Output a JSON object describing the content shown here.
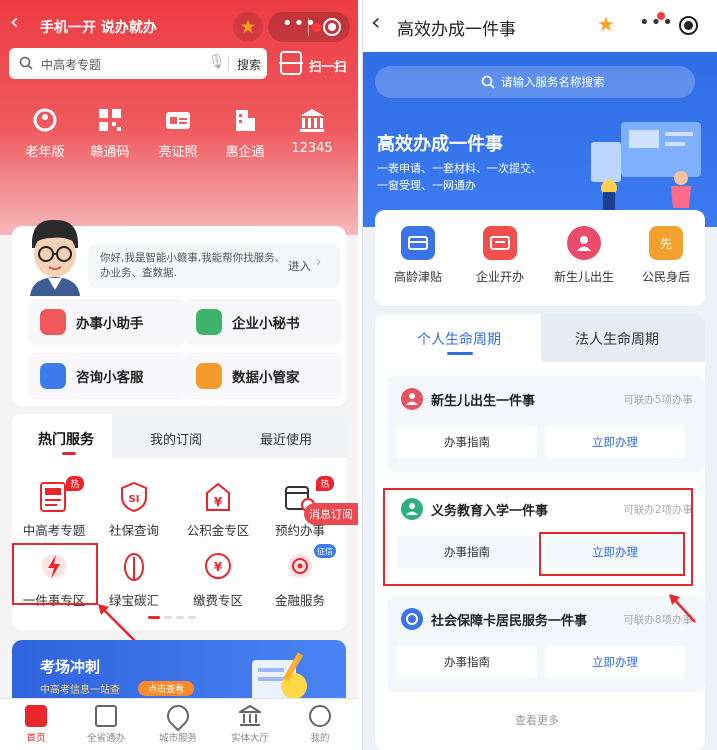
{
  "left": {
    "header": {
      "back_icon": "chevron-left-icon",
      "title": "手机一开 说办就办",
      "star_icon": "star-icon",
      "more_icon": "more-dots-icon",
      "target_icon": "target-icon"
    },
    "search": {
      "placeholder": "中高考专题",
      "button": "搜索",
      "scan_label": "扫一扫"
    },
    "quick": [
      {
        "label": "老年版",
        "icon": "elderly-icon"
      },
      {
        "label": "赣通码",
        "icon": "qrcode-icon"
      },
      {
        "label": "亮证照",
        "icon": "id-card-icon"
      },
      {
        "label": "惠企通",
        "icon": "building-icon"
      },
      {
        "label": "12345",
        "icon": "government-icon"
      }
    ],
    "assistant": {
      "text": "你好,我是智能小赣事,我能帮你找服务、办业务、查数据.",
      "enter": "进入",
      "avatar": "assistant-avatar"
    },
    "tools": [
      {
        "label": "办事小助手",
        "color": "#f0585d"
      },
      {
        "label": "企业小秘书",
        "color": "#3db36b"
      },
      {
        "label": "咨询小客服",
        "color": "#3c7bea"
      },
      {
        "label": "数据小管家",
        "color": "#f29a2b"
      }
    ],
    "tabs": [
      "热门服务",
      "我的订阅",
      "最近使用"
    ],
    "services": [
      {
        "label": "中高考专题",
        "badge": "热",
        "icon_text": "100"
      },
      {
        "label": "社保查询",
        "badge": "",
        "icon_text": "SI"
      },
      {
        "label": "公积金专区",
        "badge": "",
        "icon_text": "¥"
      },
      {
        "label": "预约办事",
        "badge": "热",
        "icon_text": ""
      },
      {
        "label": "一件事专区",
        "badge": "",
        "icon_text": ""
      },
      {
        "label": "绿宝碳汇",
        "badge": "",
        "icon_text": ""
      },
      {
        "label": "缴费专区",
        "badge": "",
        "icon_text": "¥"
      },
      {
        "label": "金融服务",
        "badge": "征信",
        "icon_text": ""
      }
    ],
    "subscribe_tag": "消息订阅",
    "banner": {
      "title": "考场冲刺",
      "subtitle": "中高考信息一站查",
      "button": "点击查看"
    },
    "nav": [
      {
        "label": "首页",
        "icon": "home-icon"
      },
      {
        "label": "全省通办",
        "icon": "document-icon"
      },
      {
        "label": "城市服务",
        "icon": "location-pin-icon"
      },
      {
        "label": "实体大厅",
        "icon": "hall-icon"
      },
      {
        "label": "我的",
        "icon": "user-icon"
      }
    ],
    "colors": {
      "primary": "#ec3c43",
      "highlight": "#e8262c"
    }
  },
  "right": {
    "header": {
      "back_icon": "chevron-left-icon",
      "title": "高效办成一件事",
      "star_icon": "star-icon",
      "more_icon": "more-dots-icon",
      "target_icon": "target-icon"
    },
    "search_placeholder": "请输入服务名称搜索",
    "banner": {
      "title": "高效办成一件事",
      "line1": "一表申请、一套材料、一次提交、",
      "line2": "一窗受理、一网通办"
    },
    "quick": [
      {
        "label": "高龄津贴",
        "color": "#3a74e8"
      },
      {
        "label": "企业开办",
        "color": "#ef4f4f"
      },
      {
        "label": "新生儿出生",
        "color": "#e84c6a"
      },
      {
        "label": "公民身后",
        "color": "#f3a12e"
      }
    ],
    "quick_icon_text": "先",
    "tabs": [
      "个人生命周期",
      "法人生命周期"
    ],
    "events": [
      {
        "title": "新生儿出生一件事",
        "count": "可联办5项办事",
        "guide": "办事指南",
        "apply": "立即办理",
        "color": "#e55462"
      },
      {
        "title": "义务教育入学一件事",
        "count": "可联办2项办事",
        "guide": "办事指南",
        "apply": "立即办理",
        "color": "#2bb07f"
      },
      {
        "title": "社会保障卡居民服务一件事",
        "count": "可联办8项办事",
        "guide": "办事指南",
        "apply": "立即办理",
        "color": "#3a74e8"
      }
    ],
    "more": "查看更多",
    "colors": {
      "primary": "#2f6ee5",
      "highlight": "#e8262c"
    }
  }
}
